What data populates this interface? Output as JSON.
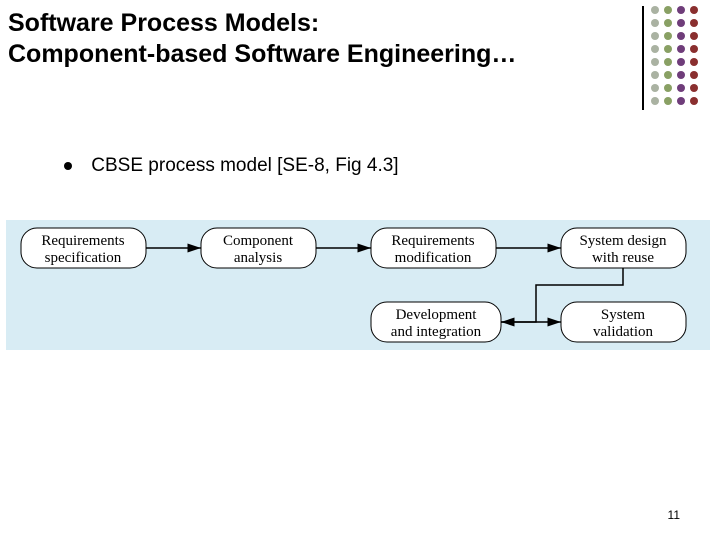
{
  "title": {
    "line1": "Software Process Models:",
    "line2": "Component-based Software Engineering…"
  },
  "bullet": "CBSE process model [SE-8, Fig 4.3]",
  "nodes": {
    "req_spec": {
      "l1": "Requirements",
      "l2": "specification"
    },
    "comp_anal": {
      "l1": "Component",
      "l2": "analysis"
    },
    "req_mod": {
      "l1": "Requirements",
      "l2": "modification"
    },
    "sys_design": {
      "l1": "System design",
      "l2": "with reuse"
    },
    "dev_int": {
      "l1": "Development",
      "l2": "and integration"
    },
    "sys_val": {
      "l1": "System",
      "l2": "validation"
    }
  },
  "pattern_colors": {
    "colA": "#aab2a2",
    "colB": "#89a064",
    "colC": "#6f3d7a",
    "colD": "#8a2f2f"
  },
  "page_number": "11"
}
